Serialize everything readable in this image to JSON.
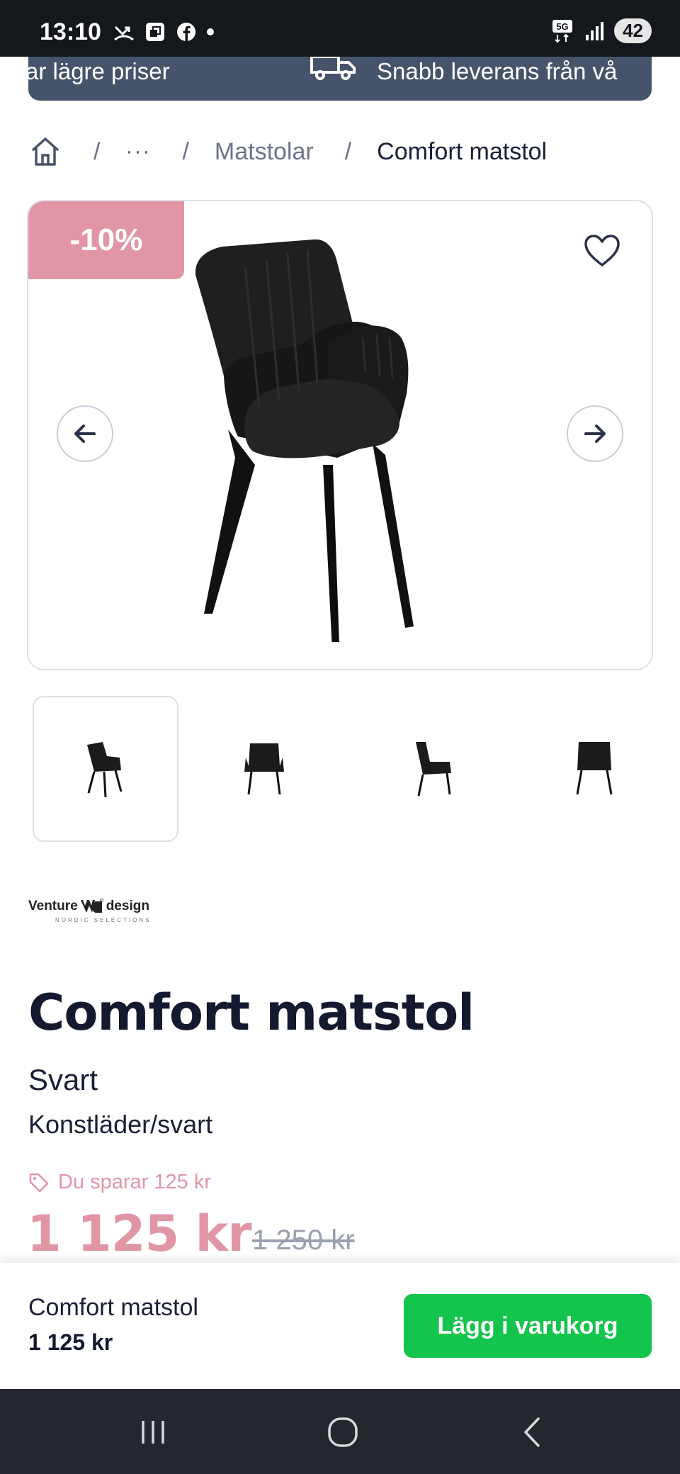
{
  "status_bar": {
    "time": "13:10",
    "battery": "42",
    "network": "5G"
  },
  "promo": {
    "text_left": "ar lägre priser",
    "text_right": "Snabb leverans från vå"
  },
  "breadcrumb": {
    "ellipsis": "···",
    "separator": "/",
    "category": "Matstolar",
    "current": "Comfort matstol"
  },
  "gallery": {
    "discount_badge": "-10%",
    "thumbnail_count": 4
  },
  "brand": {
    "name_left": "Venture",
    "name_right": "design",
    "tagline": "NORDIC SELECTIONS"
  },
  "product": {
    "title": "Comfort matstol",
    "color": "Svart",
    "material": "Konstläder/svart",
    "saving_text": "Du sparar 125 kr",
    "price_now": "1 125 kr",
    "price_old": "1 250 kr"
  },
  "sticky_bar": {
    "name": "Comfort matstol",
    "price": "1 125 kr",
    "cart_button": "Lägg i varukorg"
  },
  "colors": {
    "accent_pink": "#e196a6",
    "cta_green": "#13c44d",
    "banner": "#46546b",
    "text_dark": "#14192f"
  }
}
